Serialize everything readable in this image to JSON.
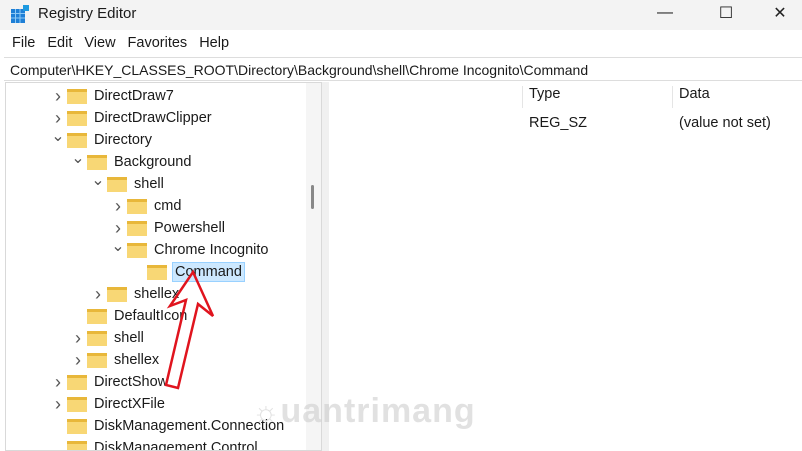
{
  "window": {
    "title": "Registry Editor",
    "minimize": "—",
    "maximize": "☐",
    "close": "✕"
  },
  "menu": [
    "File",
    "Edit",
    "View",
    "Favorites",
    "Help"
  ],
  "address": "Computer\\HKEY_CLASSES_ROOT\\Directory\\Background\\shell\\Chrome Incognito\\Command",
  "tree": [
    {
      "label": "DirectDraw7",
      "level": 0,
      "state": "collapsed"
    },
    {
      "label": "DirectDrawClipper",
      "level": 0,
      "state": "collapsed"
    },
    {
      "label": "Directory",
      "level": 0,
      "state": "expanded"
    },
    {
      "label": "Background",
      "level": 1,
      "state": "expanded"
    },
    {
      "label": "shell",
      "level": 2,
      "state": "expanded"
    },
    {
      "label": "cmd",
      "level": 3,
      "state": "collapsed"
    },
    {
      "label": "Powershell",
      "level": 3,
      "state": "collapsed"
    },
    {
      "label": "Chrome Incognito",
      "level": 3,
      "state": "expanded"
    },
    {
      "label": "Command",
      "level": 4,
      "state": "leaf",
      "selected": true
    },
    {
      "label": "shellex",
      "level": 2,
      "state": "collapsed"
    },
    {
      "label": "DefaultIcon",
      "level": 1,
      "state": "leaf"
    },
    {
      "label": "shell",
      "level": 1,
      "state": "collapsed"
    },
    {
      "label": "shellex",
      "level": 1,
      "state": "collapsed"
    },
    {
      "label": "DirectShow",
      "level": 0,
      "state": "collapsed"
    },
    {
      "label": "DirectXFile",
      "level": 0,
      "state": "collapsed"
    },
    {
      "label": "DiskManagement.Connection",
      "level": 0,
      "state": "leaf"
    },
    {
      "label": "DiskManagement.Control",
      "level": 0,
      "state": "leaf"
    }
  ],
  "list": {
    "headers": {
      "type": "Type",
      "data": "Data"
    },
    "rows": [
      {
        "type": "REG_SZ",
        "data": "(value not set)"
      }
    ]
  },
  "watermark": "uantrimang",
  "colors": {
    "arrow": "#e0141e",
    "selection": "#cce8ff"
  }
}
